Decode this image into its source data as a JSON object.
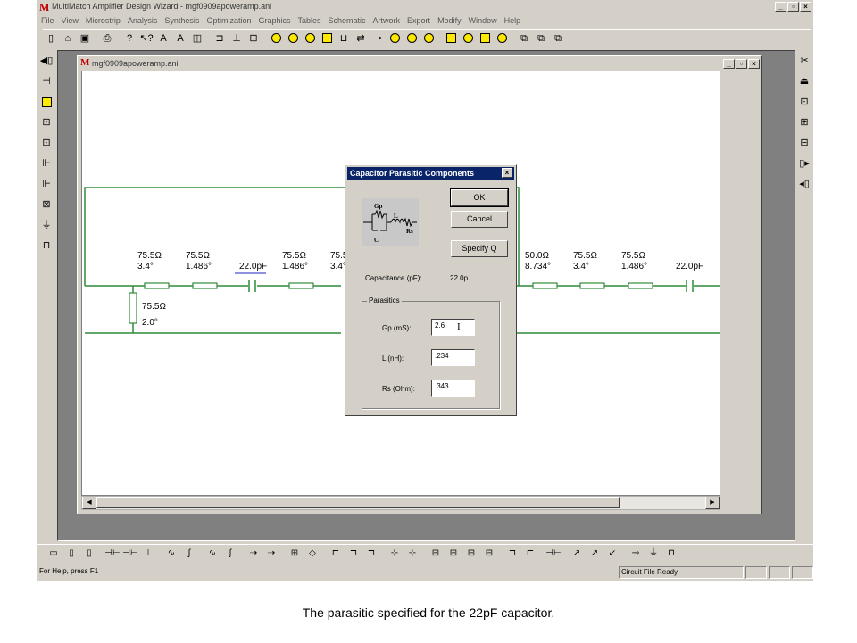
{
  "app": {
    "title": "MultiMatch Amplifier Design Wizard - mgf0909apoweramp.ani",
    "logo": "M",
    "window_buttons": [
      "_",
      "▫",
      "×"
    ]
  },
  "menu": [
    "File",
    "View",
    "Microstrip",
    "Analysis",
    "Synthesis",
    "Optimization",
    "Graphics",
    "Tables",
    "Schematic",
    "Artwork",
    "Export",
    "Modify",
    "Window",
    "Help"
  ],
  "child_window": {
    "title": "mgf0909apoweramp.ani",
    "logo": "M"
  },
  "circuit": {
    "elements_top": [
      {
        "z": "75.5Ω",
        "len": "3.4°"
      },
      {
        "z": "75.5Ω",
        "len": "1.486°"
      },
      {
        "cap": "22.0pF"
      },
      {
        "z": "75.5Ω",
        "len": "1.486°"
      },
      {
        "z": "75.5Ω",
        "len": "3.4°"
      },
      {
        "z": "50.0Ω",
        "len": "8.734°"
      },
      {
        "z": "75.5Ω",
        "len": "3.4°"
      },
      {
        "z": "75.5Ω",
        "len": "1.486°"
      },
      {
        "cap": "22.0pF"
      }
    ],
    "shunt": {
      "z": "75.5Ω",
      "len": "2.0°"
    }
  },
  "dialog": {
    "title": "Capacitor Parasitic Components",
    "close": "×",
    "ok": "OK",
    "cancel": "Cancel",
    "specify_q": "Specify Q",
    "capacitance_label": "Capacitance (pF):",
    "capacitance_value": "22.0p",
    "group_label": "Parasitics",
    "fields": [
      {
        "label": "Gp (mS):",
        "value": "2.6"
      },
      {
        "label": "L (nH):",
        "value": ".234"
      },
      {
        "label": "Rs (Ohm):",
        "value": ".343"
      }
    ],
    "schematic_labels": {
      "gp": "Gp",
      "l": "L",
      "rs": "Rs",
      "c": "C"
    }
  },
  "status": {
    "help": "For Help, press F1",
    "file": "Circuit File Ready"
  },
  "caption": "The parasitic specified for the 22pF capacitor.",
  "colors": {
    "wire": "#2e8b3a",
    "title_active": "#0a246a",
    "face": "#d4d0c8"
  }
}
